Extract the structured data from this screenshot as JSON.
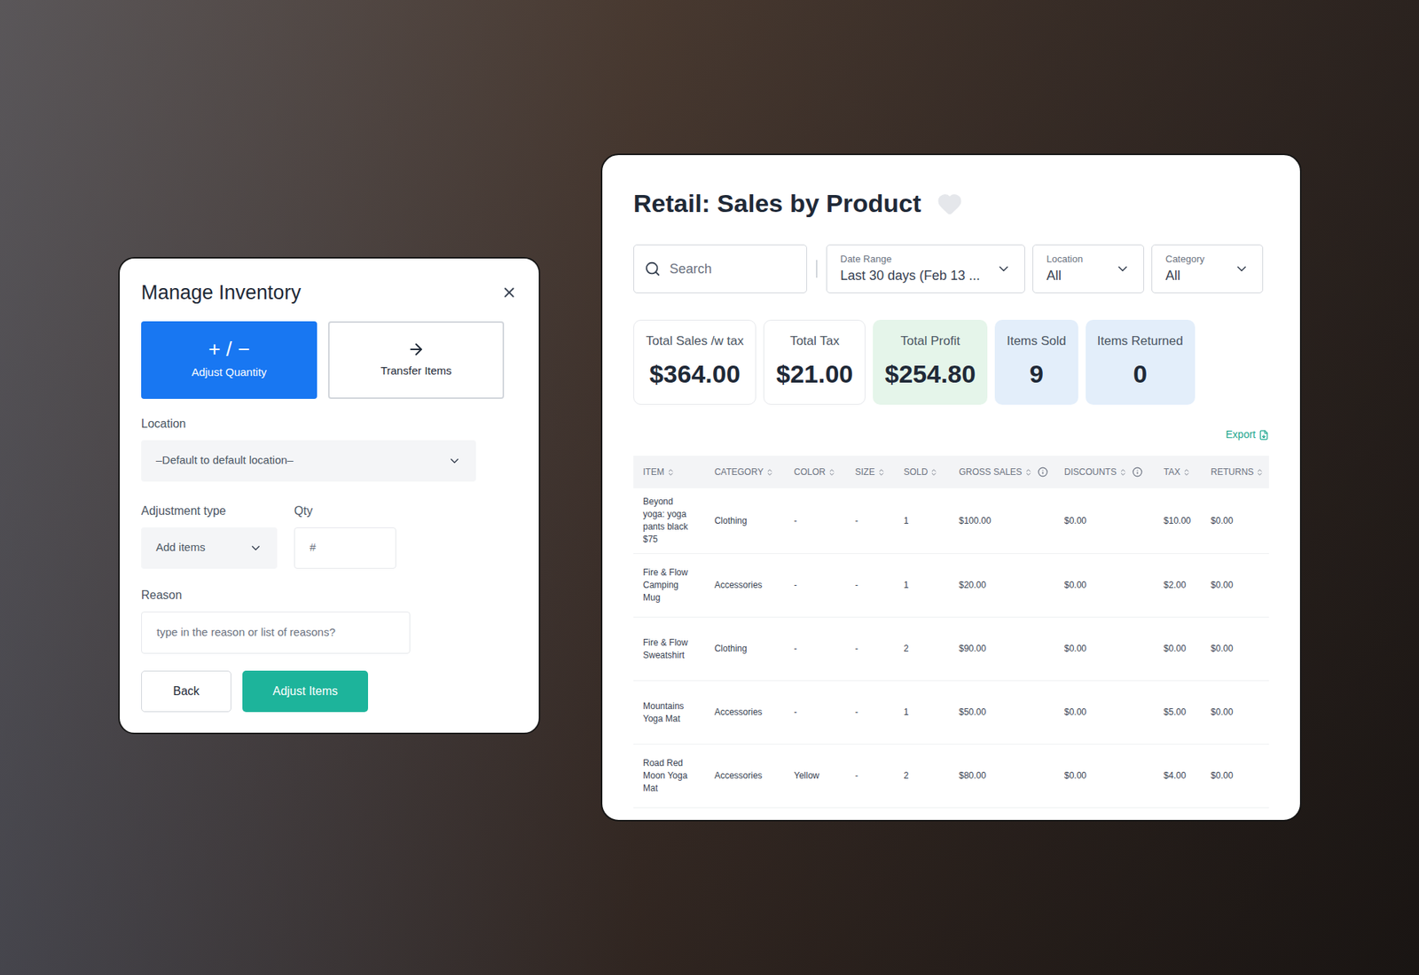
{
  "inventory_dialog": {
    "title": "Manage Inventory",
    "tabs": [
      {
        "label": "Adjust Quantity",
        "glyph": "+ / −",
        "selected": true
      },
      {
        "label": "Transfer Items",
        "glyph": "",
        "selected": false
      }
    ],
    "location": {
      "label": "Location",
      "value": "–Default to default location–"
    },
    "adjustment_type": {
      "label": "Adjustment type",
      "value": "Add items"
    },
    "qty": {
      "label": "Qty",
      "placeholder": "#"
    },
    "reason": {
      "label": "Reason",
      "placeholder": "type in the reason or list of reasons?"
    },
    "buttons": [
      "Back",
      "Adjust Items"
    ]
  },
  "sales_report": {
    "title": "Retail: Sales by Product",
    "favorited": false,
    "search": {
      "placeholder": "Search"
    },
    "filters": [
      {
        "label": "Date Range",
        "value": "Last 30 days (Feb 13 ..."
      },
      {
        "label": "Location",
        "value": "All"
      },
      {
        "label": "Category",
        "value": "All"
      }
    ],
    "stats": [
      {
        "label": "Total Sales /w tax",
        "value": "$364.00",
        "color": "#ffffff"
      },
      {
        "label": "Total Tax",
        "value": "$21.00",
        "color": "#ffffff"
      },
      {
        "label": "Total Profit",
        "value": "$254.80",
        "color": "#e5f5ea"
      },
      {
        "label": "Items Sold",
        "value": "9",
        "color": "#e3eefa"
      },
      {
        "label": "Items Returned",
        "value": "0",
        "color": "#e3eefa"
      }
    ],
    "export": "Export",
    "columns": [
      {
        "label": "ITEM",
        "info": false
      },
      {
        "label": "CATEGORY",
        "info": false
      },
      {
        "label": "COLOR",
        "info": false
      },
      {
        "label": "SIZE",
        "info": false
      },
      {
        "label": "SOLD",
        "info": false
      },
      {
        "label": "GROSS SALES",
        "info": true
      },
      {
        "label": "DISCOUNTS",
        "info": true
      },
      {
        "label": "TAX",
        "info": false
      },
      {
        "label": "RETURNS",
        "info": false
      }
    ],
    "rows": [
      [
        "Beyond yoga: yoga pants black $75",
        "Clothing",
        "-",
        "-",
        "1",
        "$100.00",
        "$0.00",
        "$10.00",
        "$0.00"
      ],
      [
        "Fire & Flow Camping Mug",
        "Accessories",
        "-",
        "-",
        "1",
        "$20.00",
        "$0.00",
        "$2.00",
        "$0.00"
      ],
      [
        "Fire & Flow Sweatshirt",
        "Clothing",
        "-",
        "-",
        "2",
        "$90.00",
        "$0.00",
        "$0.00",
        "$0.00"
      ],
      [
        "Mountains Yoga Mat",
        "Accessories",
        "-",
        "-",
        "1",
        "$50.00",
        "$0.00",
        "$5.00",
        "$0.00"
      ],
      [
        "Road Red Moon Yoga Mat",
        "Accessories",
        "Yellow",
        "-",
        "2",
        "$80.00",
        "$0.00",
        "$4.00",
        "$0.00"
      ]
    ]
  }
}
